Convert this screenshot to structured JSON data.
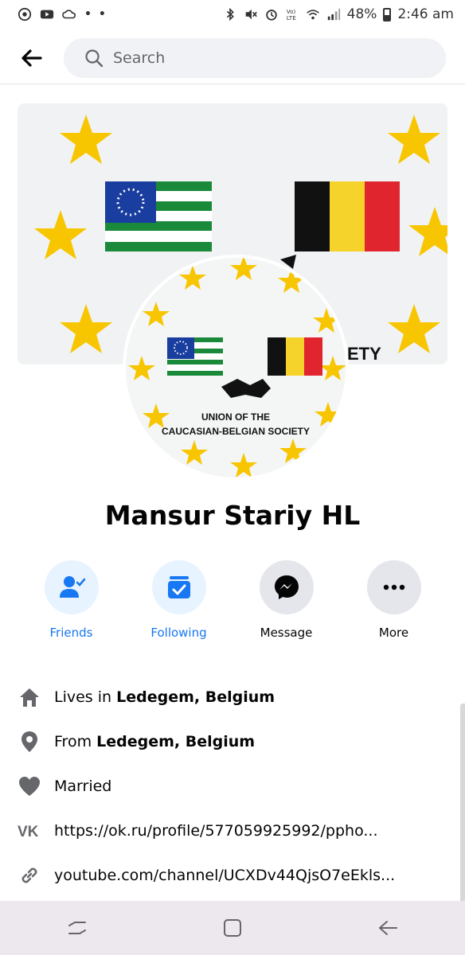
{
  "status_bar": {
    "left_icons": [
      "accessibility-icon",
      "youtube-icon",
      "cloud-icon"
    ],
    "more_dots": "• •",
    "battery": "48%",
    "time": "2:46 am"
  },
  "header": {
    "search_placeholder": "Search"
  },
  "cover": {
    "logo_text_line1": "UNION OF THE",
    "logo_text_line2": "CAUCASIAN-BELGIAN SOCIETY",
    "cover_partial_text": "ETY"
  },
  "profile": {
    "name": "Mansur Stariy HL"
  },
  "actions": [
    {
      "label": "Friends",
      "icon": "friends-icon",
      "active": true
    },
    {
      "label": "Following",
      "icon": "following-icon",
      "active": true
    },
    {
      "label": "Message",
      "icon": "messenger-icon",
      "active": false
    },
    {
      "label": "More",
      "icon": "more-icon",
      "active": false
    }
  ],
  "intro": {
    "lives_prefix": "Lives in ",
    "lives_place": "Ledegem, Belgium",
    "from_prefix": "From ",
    "from_place": "Ledegem, Belgium",
    "relationship": "Married",
    "vk_link": "https://ok.ru/profile/577059925992/ppho...",
    "youtube_link": "youtube.com/channel/UCXDv44QjsO7eEkls..."
  },
  "colors": {
    "accent": "#1877f2",
    "star": "#f7c600",
    "flag_green": "#1a8a3a",
    "flag_blue": "#1a3ea0",
    "belgium_black": "#111111",
    "belgium_yellow": "#f6d32a",
    "belgium_red": "#e1252f"
  }
}
